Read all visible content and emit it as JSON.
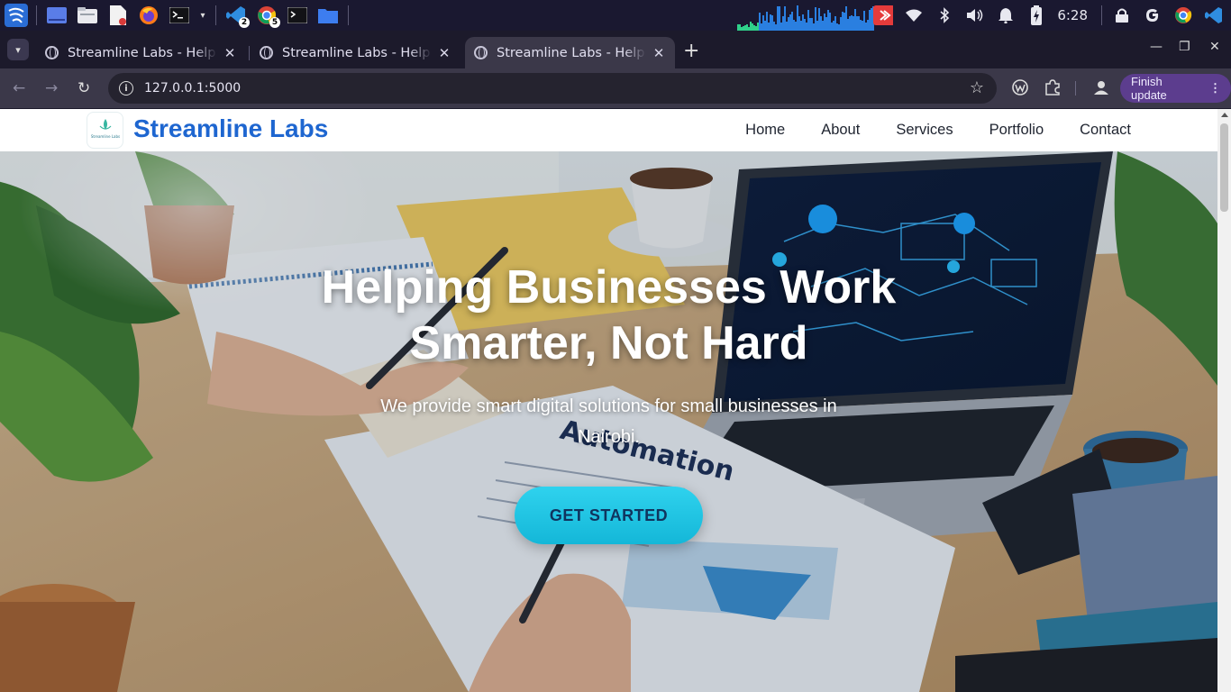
{
  "os": {
    "clock": "6:28",
    "badges": {
      "vscode": "2",
      "chrome": "5"
    },
    "tray_icons": [
      "battery-icon",
      "wifi-icon",
      "bluetooth-icon",
      "volume-icon",
      "notification-bell-icon",
      "battery-charging-icon",
      "lock-icon",
      "google-icon",
      "chrome-icon",
      "vscode-icon"
    ]
  },
  "browser": {
    "tabs": [
      {
        "title": "Streamline Labs - Help Bu"
      },
      {
        "title": "Streamline Labs - Help Bu"
      },
      {
        "title": "Streamline Labs - Help Bu"
      }
    ],
    "active_tab": 2,
    "url": "127.0.0.1:5000",
    "finish_update": "Finish update"
  },
  "site": {
    "brand": "Streamline Labs",
    "logo_text": "Streamline Labs",
    "nav": [
      "Home",
      "About",
      "Services",
      "Portfolio",
      "Contact"
    ],
    "hero": {
      "title": "Helping Businesses Work Smarter, Not Hard",
      "subtitle": "We provide smart digital solutions for small businesses in Nairobi.",
      "cta": "GET STARTED",
      "paper_text": "Automation"
    }
  },
  "colors": {
    "brand_blue": "#1e66d0",
    "cta_cyan": "#22c6e4",
    "update_purple": "#5c3d8e"
  }
}
